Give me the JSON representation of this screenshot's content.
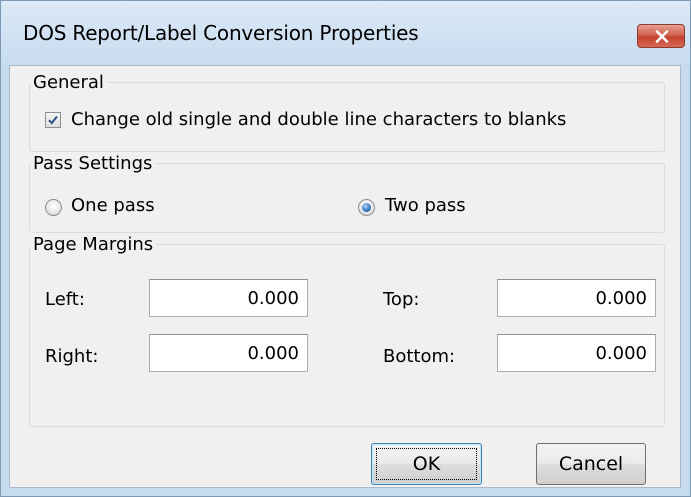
{
  "window": {
    "title": "DOS Report/Label Conversion Properties"
  },
  "general": {
    "title": "General",
    "checkbox_label": "Change old single and double line characters to blanks",
    "checked": true
  },
  "pass_settings": {
    "title": "Pass Settings",
    "option_one": "One pass",
    "option_two": "Two pass",
    "selected": "Two pass"
  },
  "page_margins": {
    "title": "Page Margins",
    "left_label": "Left:",
    "left_value": "0.000",
    "right_label": "Right:",
    "right_value": "0.000",
    "top_label": "Top:",
    "top_value": "0.000",
    "bottom_label": "Bottom:",
    "bottom_value": "0.000"
  },
  "buttons": {
    "ok": "OK",
    "cancel": "Cancel"
  },
  "icons": {
    "close": "close-icon",
    "check": "check-icon"
  },
  "colors": {
    "frame": "#c7dbee",
    "close_button": "#c2432f",
    "radio_selected": "#3a77c1",
    "client": "#f0f0f0"
  }
}
